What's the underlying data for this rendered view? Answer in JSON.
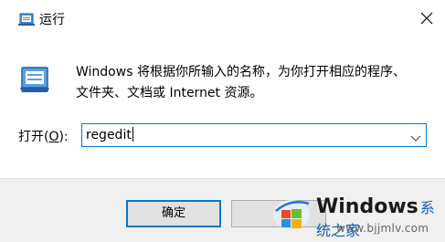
{
  "window": {
    "title": "运行",
    "close_icon": "close-icon"
  },
  "dialog": {
    "description_line1": "Windows 将根据你所输入的名称，为你打开相应的程序、",
    "description_line2": "文件夹、文档或 Internet 资源。",
    "open_label_prefix": "打开(",
    "open_label_hotkey": "O",
    "open_label_suffix": "):",
    "input_value": "regedit"
  },
  "buttons": {
    "ok_label": "确定",
    "cancel_label": ""
  },
  "watermark": {
    "brand": "Windows",
    "brand_cn": "系统之家",
    "url": "www.bjjmlv.com"
  },
  "colors": {
    "accent": "#0078d7",
    "footer_bg": "#f0f0f0"
  }
}
